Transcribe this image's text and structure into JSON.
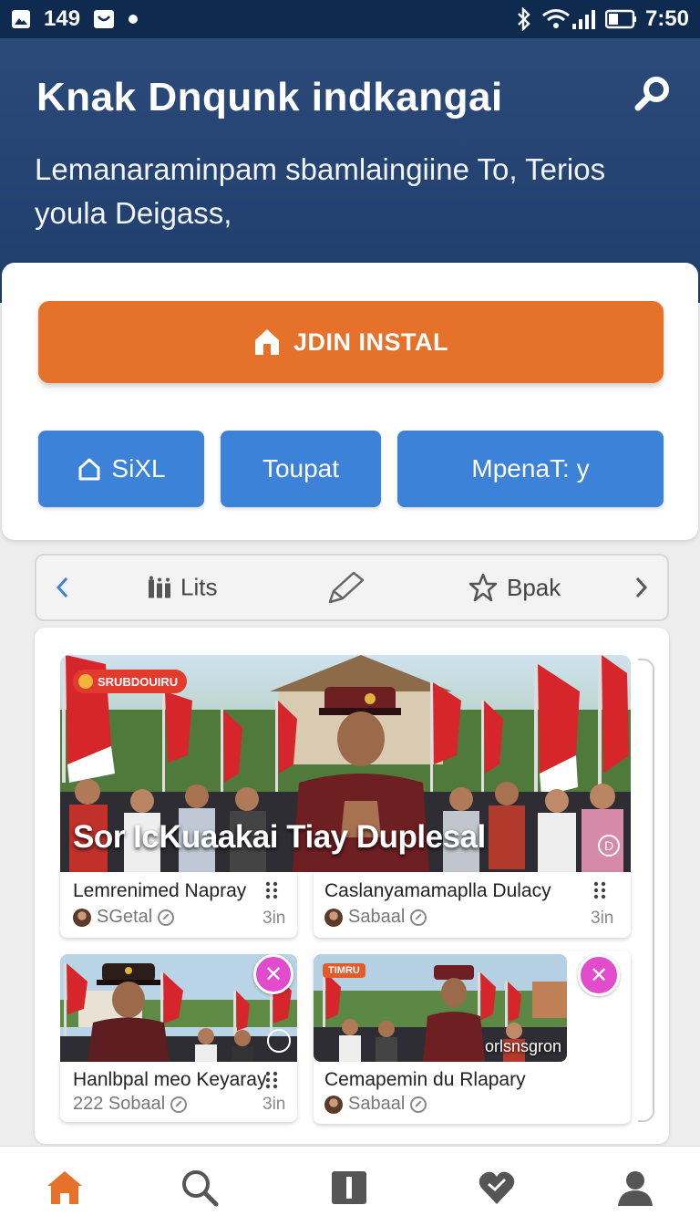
{
  "status_bar": {
    "time": "7:50",
    "notif_count": "149"
  },
  "header": {
    "title": "Knak Dnqunk indkangai",
    "subtitle": "Lemanaraminpam sbamlaingiine To, Terios youla Deigass,"
  },
  "actions": {
    "primary_label": "JDIN INSTAL",
    "secondary": [
      {
        "label": "SiXL",
        "icon": "home-icon"
      },
      {
        "label": "Toupat"
      },
      {
        "label": "MpenaT: y"
      }
    ]
  },
  "filter_bar": {
    "items": [
      {
        "label": "Lits",
        "icon": "grid-icon"
      },
      {
        "label": "",
        "icon": "pencil-icon"
      },
      {
        "label": "Bpak",
        "icon": "star-icon"
      }
    ]
  },
  "feature": {
    "badge": "SRUBDOUIRU",
    "title": "Sor IcKuaakai Tiay Duplesal"
  },
  "cards": [
    {
      "title": "Lemrenimed Napray",
      "author": "SGetal",
      "time": "3in"
    },
    {
      "title": "Caslanyamamaplla Dulacy",
      "author": "Sabaal",
      "time": "3in"
    },
    {
      "title": "Hanlbpal meo Keyaray",
      "author": "222 Sobaal",
      "time": "3in"
    },
    {
      "title": "Cemapemin du Rlapary",
      "author": "Sabaal",
      "time": ""
    }
  ],
  "small_images": [
    {
      "badge": ""
    },
    {
      "badge": "TIMRU",
      "overlay": "orlsnsgron"
    }
  ],
  "bottom_nav": [
    "home-icon",
    "search-icon",
    "library-icon",
    "heart-icon",
    "profile-icon"
  ],
  "colors": {
    "header": "#203e6c",
    "accent": "#e5712a",
    "button": "#3b82d8",
    "pink": "#e24ccc"
  }
}
